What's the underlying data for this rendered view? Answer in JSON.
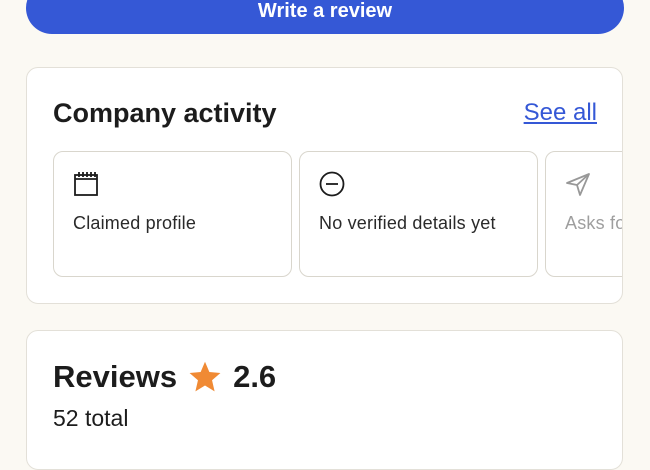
{
  "buttons": {
    "write_review": "Write a review"
  },
  "activity": {
    "title": "Company activity",
    "see_all": "See all",
    "items": [
      {
        "icon": "calendar-icon",
        "label": "Claimed profile"
      },
      {
        "icon": "minus-circle-icon",
        "label": "No verified details yet"
      },
      {
        "icon": "send-icon",
        "label": "Asks for positive"
      }
    ]
  },
  "reviews": {
    "title": "Reviews",
    "rating": "2.6",
    "total": "52 total",
    "star_color": "#f08a34"
  },
  "colors": {
    "accent": "#3558d6",
    "background": "#fbf9f3"
  }
}
